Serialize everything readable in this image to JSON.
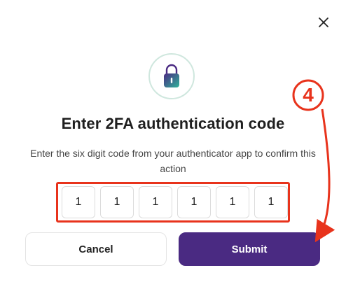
{
  "dialog": {
    "title": "Enter 2FA authentication code",
    "subtitle": "Enter the six digit code from your authenticator app to confirm this action",
    "close_icon": "close-icon",
    "lock_icon": "lock-icon"
  },
  "code": {
    "digits": [
      "1",
      "1",
      "1",
      "1",
      "1",
      "1"
    ]
  },
  "buttons": {
    "cancel_label": "Cancel",
    "submit_label": "Submit"
  },
  "annotation": {
    "step": "4",
    "color": "#e8331c"
  },
  "colors": {
    "primary": "#4a2a82",
    "lock_gradient_start": "#4a2a82",
    "lock_gradient_end": "#2fb39a",
    "highlight": "#e8331c"
  }
}
